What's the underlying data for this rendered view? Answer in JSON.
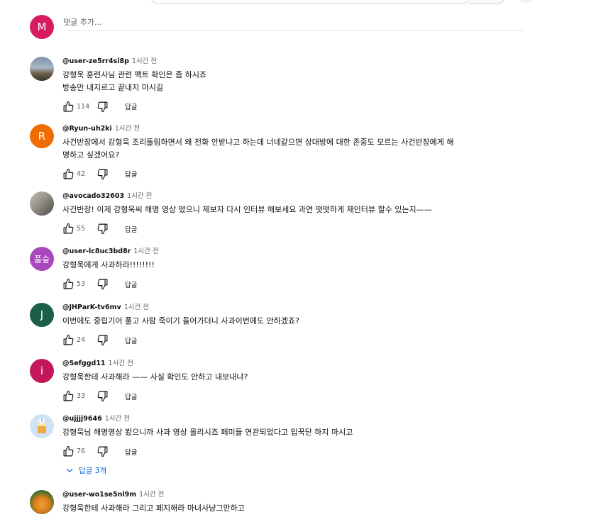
{
  "add_comment": {
    "avatar_letter": "M",
    "avatar_color": "#d81b60",
    "placeholder": "댓글 추가..."
  },
  "comments": [
    {
      "author": "@user-ze5rr4si8p",
      "time": "1시간 전",
      "text": "강형욱  훈련사님 관련 팩트 확인은 좀 하시죠\n방송만 내지르고 끝내지 마시길",
      "likes": "114",
      "reply_label": "답글",
      "avatar_letter": "",
      "avatar_color": "#8a9bb0"
    },
    {
      "author": "@Ryun-uh2ki",
      "time": "1시간 전",
      "text": "사건반장에서 강형욱 조리돌림하면서 왜 전화 안받냐고 하는데 너네같으면 상대방에 대한 존중도 모르는 사건반장에게 해\n명하고 싶겠어요?",
      "likes": "42",
      "reply_label": "답글",
      "avatar_letter": "R",
      "avatar_color": "#ef6c00"
    },
    {
      "author": "@avocado32603",
      "time": "1시간 전",
      "text": "사건반장! 이제 강형욱씨 해명 영상 떴으니 제보자 다시 인터뷰 해보세요 과연 떳떳하게 재인터뷰 할수 있는지——",
      "likes": "55",
      "reply_label": "답글",
      "avatar_letter": "",
      "avatar_color": "#8e8a80"
    },
    {
      "author": "@user-lc8uc3bd8r",
      "time": "1시간 전",
      "text": "강형욱에게 사과하라!!!!!!!!",
      "likes": "53",
      "reply_label": "답글",
      "avatar_letter": "풀숲",
      "avatar_color": "#ab47bc"
    },
    {
      "author": "@JHParK-tv6mv",
      "time": "1시간 전",
      "text": "이번에도 중립기어 풀고 사람 죽이기 들어가더니 사과이번에도 안하겠죠?",
      "likes": "24",
      "reply_label": "답글",
      "avatar_letter": "J",
      "avatar_color": "#1b5e4a"
    },
    {
      "author": "@Sefggd11",
      "time": "1시간 전",
      "text": "강형욱한테 사과해라 —— 사실 확인도 안하고 내보내냐?",
      "likes": "33",
      "reply_label": "답글",
      "avatar_letter": "i",
      "avatar_color": "#c2185b"
    },
    {
      "author": "@ujjjj9646",
      "time": "1시간 전",
      "text": "강형욱님 해명영상 봤으니까 사과 영상 올리시죠 페미들 연관되었다고 입꾹닫 하지 마시고",
      "likes": "76",
      "reply_label": "답글",
      "avatar_letter": "",
      "avatar_color": "#cfe3f5"
    },
    {
      "author": "@user-wo1se5nl9m",
      "time": "1시간 전",
      "text": "강형욱한테 사과해라 그리고 페지해라 마녀사냥그만하고",
      "likes": "",
      "reply_label": "",
      "avatar_letter": "",
      "avatar_color": "#2f6d2d"
    }
  ],
  "replies_toggle": {
    "label": "답글 3개",
    "color": "#065fd4"
  },
  "icons": {
    "like": "thumbs-up-icon",
    "dislike": "thumbs-down-icon",
    "expand": "chevron-down-icon"
  }
}
